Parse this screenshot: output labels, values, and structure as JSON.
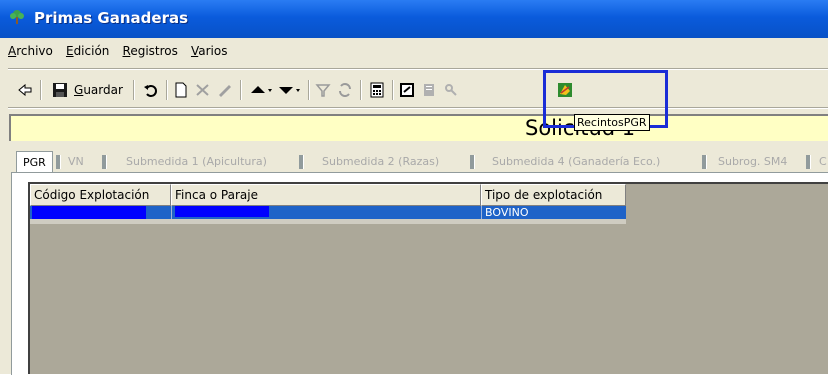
{
  "window": {
    "title": "Primas Ganaderas"
  },
  "menubar": {
    "items": [
      {
        "label": "Archivo",
        "accel": "A",
        "rest": "rchivo"
      },
      {
        "label": "Edición",
        "accel": "E",
        "rest": "dición"
      },
      {
        "label": "Registros",
        "accel": "R",
        "rest": "egistros"
      },
      {
        "label": "Varios",
        "accel": "V",
        "rest": "arios"
      }
    ]
  },
  "toolbar": {
    "save_accel": "G",
    "save_rest": "uardar",
    "save_label": "Guardar",
    "tooltip": "RecintosPGR"
  },
  "header": {
    "solicitud": "Solicitud 1"
  },
  "tabs": [
    {
      "label": "PGR",
      "state": "active"
    },
    {
      "label": "VN",
      "state": "disabled"
    },
    {
      "label": "Submedida 1 (Apicultura)",
      "state": "disabled"
    },
    {
      "label": "Submedida 2 (Razas)",
      "state": "disabled"
    },
    {
      "label": "Submedida 4 (Ganadería Eco.)",
      "state": "disabled"
    },
    {
      "label": "Subrog. SM4",
      "state": "disabled"
    },
    {
      "label": "C",
      "state": "disabled"
    }
  ],
  "grid": {
    "columns": [
      "Código Explotación",
      "Finca o Paraje",
      "Tipo de explotación"
    ],
    "rows": [
      {
        "codigo": "",
        "finca": "",
        "tipo": "BOVINO"
      }
    ]
  },
  "colors": {
    "title_bar": "#0a5bdc",
    "selection": "#1f63c8",
    "highlight_box": "#1a2dd6",
    "info_bar": "#ffffc4",
    "redaction": "#0000ff"
  }
}
